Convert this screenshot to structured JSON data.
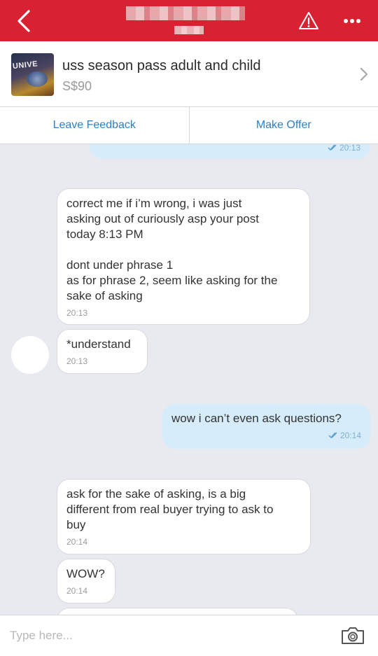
{
  "header": {
    "back_icon": "back-chevron-icon",
    "warning_icon": "warning-icon",
    "more_icon": "more-icon",
    "background_color": "#d92231"
  },
  "listing": {
    "thumbnail_text": "UNIVE",
    "title": "uss season pass adult and child",
    "price": "S$90"
  },
  "actions": {
    "leave_feedback": "Leave Feedback",
    "make_offer": "Make Offer",
    "accent_color": "#2f7fc1"
  },
  "messages": [
    {
      "direction": "out",
      "text": "",
      "time": "20:13",
      "read": true
    },
    {
      "direction": "in",
      "text": "correct me if i’m wrong, i was just\nasking out of curiously asp your post\ntoday 8:13 PM\n\ndont under phrase 1\nas for phrase 2, seem like asking for the\nsake of asking",
      "time": "20:13"
    },
    {
      "direction": "in",
      "text": "*understand",
      "time": "20:13"
    },
    {
      "direction": "out",
      "text": "wow i can’t even ask questions?",
      "time": "20:14",
      "read": true
    },
    {
      "direction": "in",
      "text": "ask for the sake of asking, is a big\ndifferent from real buyer trying to ask to\nbuy",
      "time": "20:14"
    },
    {
      "direction": "in",
      "text": "WOW?",
      "time": "20:14"
    }
  ],
  "composer": {
    "placeholder": "Type here...",
    "value": "",
    "camera_icon": "camera-icon"
  }
}
